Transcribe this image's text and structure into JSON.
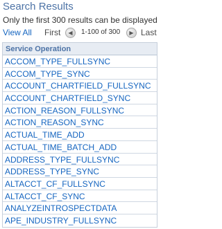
{
  "header": {
    "title": "Search Results",
    "note": "Only the first 300 results can be displayed"
  },
  "nav": {
    "view_all": "View All",
    "first": "First",
    "prev_icon": "left-arrow-icon",
    "range": "1-100 of 300",
    "next_icon": "right-arrow-icon",
    "last": "Last"
  },
  "table": {
    "column_header": "Service Operation",
    "rows": [
      "ACCOM_TYPE_FULLSYNC",
      "ACCOM_TYPE_SYNC",
      "ACCOUNT_CHARTFIELD_FULLSYNC",
      "ACCOUNT_CHARTFIELD_SYNC",
      "ACTION_REASON_FULLSYNC",
      "ACTION_REASON_SYNC",
      "ACTUAL_TIME_ADD",
      "ACTUAL_TIME_BATCH_ADD",
      "ADDRESS_TYPE_FULLSYNC",
      "ADDRESS_TYPE_SYNC",
      "ALTACCT_CF_FULLSYNC",
      "ALTACCT_CF_SYNC",
      "ANALYZEINTROSPECTDATA",
      "APE_INDUSTRY_FULLSYNC"
    ]
  },
  "colors": {
    "title": "#4d73a6",
    "link": "#1565c0",
    "header_bg": "#e7ecf3",
    "border": "#c6cfdb"
  }
}
